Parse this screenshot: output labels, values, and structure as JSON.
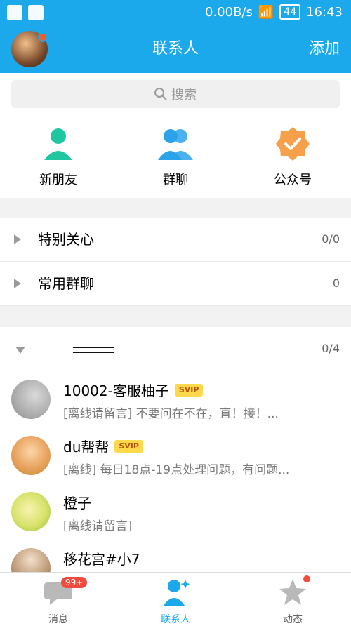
{
  "status_bar": {
    "speed": "0.00B/s",
    "battery": "44",
    "time": "16:43"
  },
  "header": {
    "title": "联系人",
    "add_label": "添加"
  },
  "search": {
    "placeholder": "搜索"
  },
  "quick": [
    {
      "label": "新朋友",
      "icon": "person-icon",
      "color": "#1fc7a0"
    },
    {
      "label": "群聊",
      "icon": "group-icon",
      "color": "#2aa3ea"
    },
    {
      "label": "公众号",
      "icon": "badge-check-icon",
      "color": "#f6a14a"
    }
  ],
  "groups": [
    {
      "title": "特别关心",
      "count": "0/0"
    },
    {
      "title": "常用群聊",
      "count": "0"
    }
  ],
  "section": {
    "title": "",
    "count": "0/4"
  },
  "contacts": [
    {
      "name": "10002-客服柚子",
      "svip": "SVIP",
      "status": "[离线请留言] 不要问在不在，直！接！..."
    },
    {
      "name": "du帮帮",
      "svip": "SVIP",
      "status": "[离线] 每日18点-19点处理问题，有问题..."
    },
    {
      "name": "橙子",
      "svip": "",
      "status": "[离线请留言]"
    },
    {
      "name": "移花宫#小7",
      "svip": "",
      "status": ""
    }
  ],
  "tabbar": [
    {
      "label": "消息",
      "badge": "99+"
    },
    {
      "label": "联系人"
    },
    {
      "label": "动态"
    }
  ],
  "colors": {
    "accent": "#1ba9ec",
    "badge": "#f24a3d"
  }
}
